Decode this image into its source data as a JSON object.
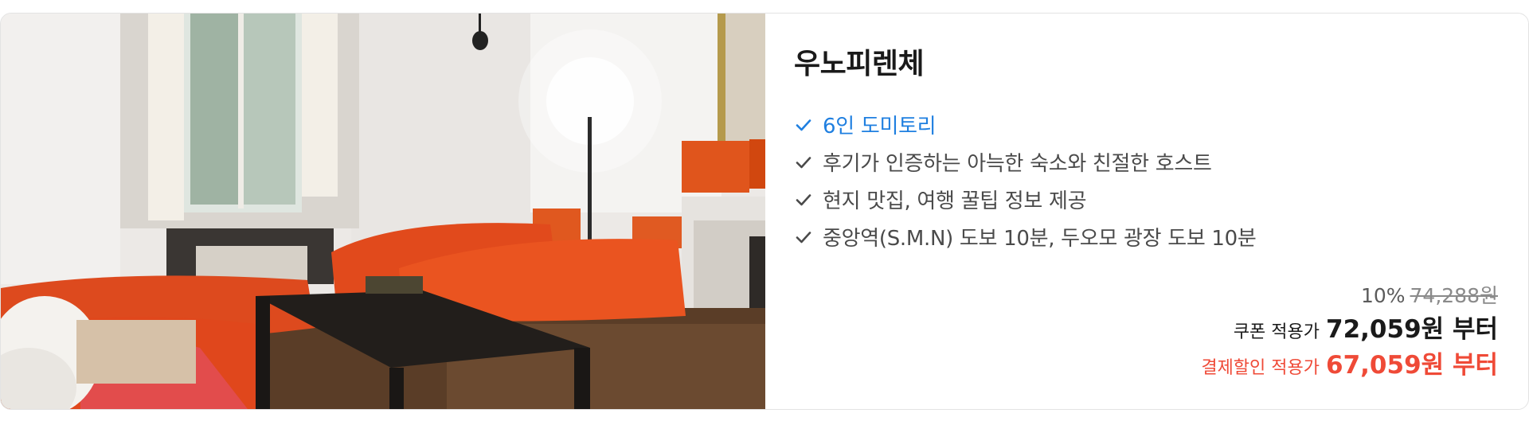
{
  "listing": {
    "title": "우노피렌체",
    "features": [
      {
        "text": "6인 도미토리",
        "highlight": true
      },
      {
        "text": "후기가 인증하는 아늑한 숙소와 친절한 호스트",
        "highlight": false
      },
      {
        "text": "현지 맛집, 여행 꿀팁 정보 제공",
        "highlight": false
      },
      {
        "text": "중앙역(S.M.N) 도보 10분, 두오모 광장 도보 10분",
        "highlight": false
      }
    ],
    "price": {
      "discount_rate": "10%",
      "original_price": "74,288원",
      "coupon_label": "쿠폰 적용가",
      "coupon_price": "72,059원 부터",
      "payment_label": "결제할인 적용가",
      "payment_price": "67,059원 부터"
    }
  },
  "colors": {
    "highlight_blue": "#1f7fe0",
    "sale_red": "#ef4a37",
    "text_dark": "#1a1a1a",
    "text_body": "#4a4a4a"
  },
  "icons": {
    "feature_check": "check-icon"
  }
}
